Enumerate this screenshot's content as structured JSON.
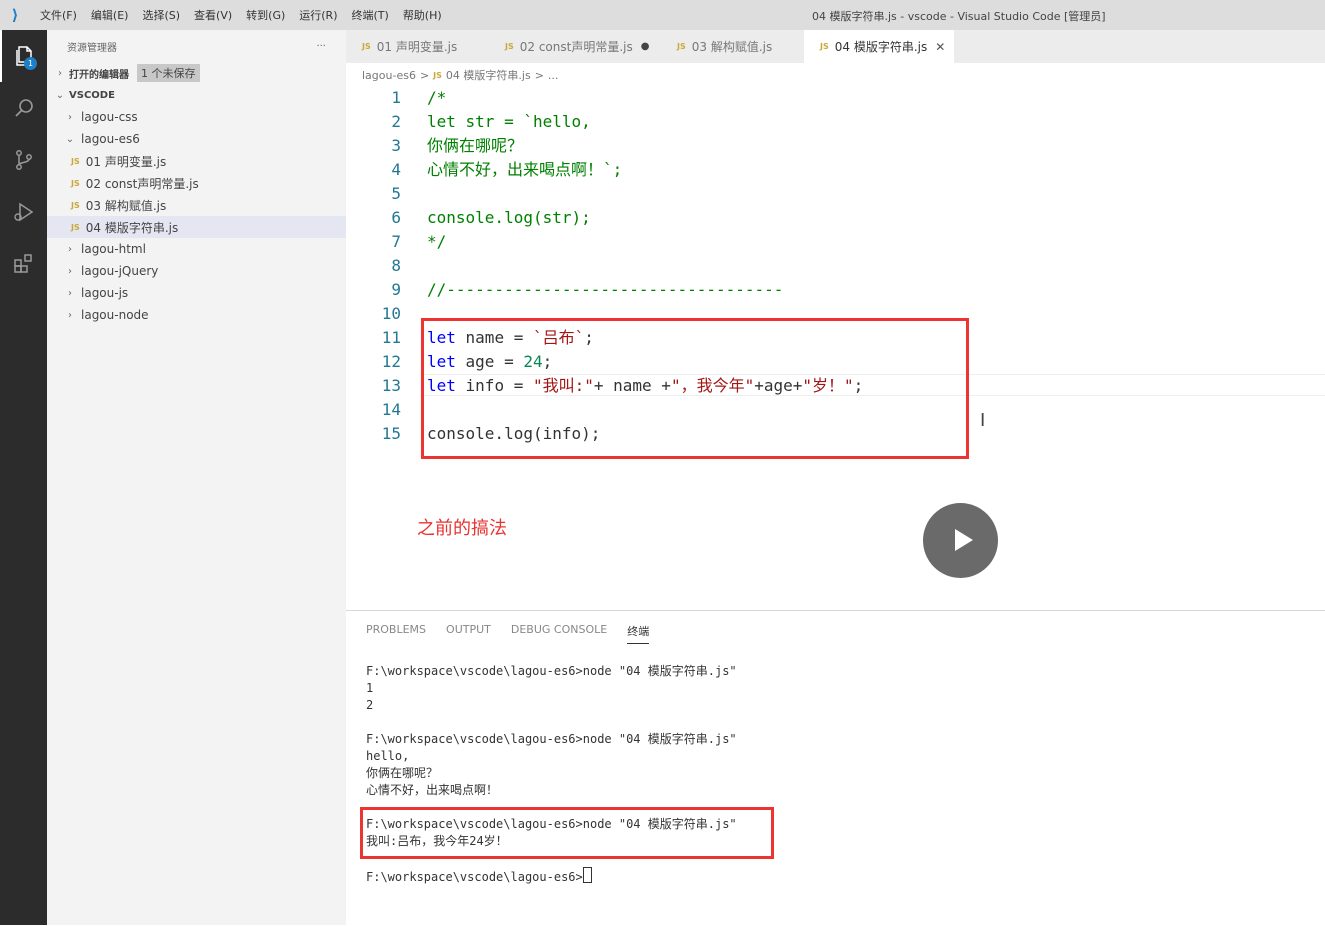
{
  "titlebar": {
    "menu": [
      "文件(F)",
      "编辑(E)",
      "选择(S)",
      "查看(V)",
      "转到(G)",
      "运行(R)",
      "终端(T)",
      "帮助(H)"
    ],
    "window_title": "04 模版字符串.js - vscode - Visual Studio Code [管理员]"
  },
  "activity": {
    "badge": "1"
  },
  "sidebar": {
    "header": "资源管理器",
    "more": "···",
    "open_editors": "打开的编辑器",
    "unsaved": "1 个未保存",
    "workspace": "VSCODE",
    "items": [
      {
        "label": "lagou-css"
      },
      {
        "label": "lagou-es6"
      },
      {
        "label": "01 声明变量.js"
      },
      {
        "label": "02 const声明常量.js"
      },
      {
        "label": "03 解构赋值.js"
      },
      {
        "label": "04 模版字符串.js"
      },
      {
        "label": "lagou-html"
      },
      {
        "label": "lagou-jQuery"
      },
      {
        "label": "lagou-js"
      },
      {
        "label": "lagou-node"
      }
    ]
  },
  "tabs": [
    {
      "label": "01 声明变量.js"
    },
    {
      "label": "02 const声明常量.js"
    },
    {
      "label": "03 解构赋值.js"
    },
    {
      "label": "04 模版字符串.js"
    }
  ],
  "js_badge": "JS",
  "breadcrumb": {
    "folder": "lagou-es6",
    "sep": ">",
    "file": "04 模版字符串.js",
    "more": "..."
  },
  "editor": {
    "line_numbers": [
      "1",
      "2",
      "3",
      "4",
      "5",
      "6",
      "7",
      "8",
      "9",
      "10",
      "11",
      "12",
      "13",
      "14",
      "15"
    ],
    "l1": "/*",
    "l2": "let str = `hello,",
    "l3": "你俩在哪呢？",
    "l4": "心情不好，出来喝点啊！`;",
    "l6": "console.log(str);",
    "l7": "*/",
    "l9": "//-----------------------------------",
    "kw_let": "let",
    "l11_a": " name = ",
    "l11_str": "`吕布`",
    "l11_b": ";",
    "l12_a": " age = ",
    "l12_num": "24",
    "l12_b": ";",
    "l13_a": " info = ",
    "l13_s1": "\"我叫:\"",
    "l13_b": "+ name +",
    "l13_s2": "\"，我今年\"",
    "l13_c": "+age+",
    "l13_s3": "\"岁！\"",
    "l13_d": ";",
    "l15": "console.log(info);"
  },
  "annotation": "之前的搞法",
  "panel": {
    "tabs": [
      "PROBLEMS",
      "OUTPUT",
      "DEBUG CONSOLE",
      "终端"
    ],
    "terminal": [
      "F:\\workspace\\vscode\\lagou-es6>node \"04 模版字符串.js\"",
      "1",
      "2",
      "",
      "F:\\workspace\\vscode\\lagou-es6>node \"04 模版字符串.js\"",
      "hello,",
      "你俩在哪呢？",
      "心情不好，出来喝点啊！",
      "",
      "F:\\workspace\\vscode\\lagou-es6>node \"04 模版字符串.js\"",
      "我叫:吕布，我今年24岁！",
      "",
      "F:\\workspace\\vscode\\lagou-es6>"
    ]
  }
}
